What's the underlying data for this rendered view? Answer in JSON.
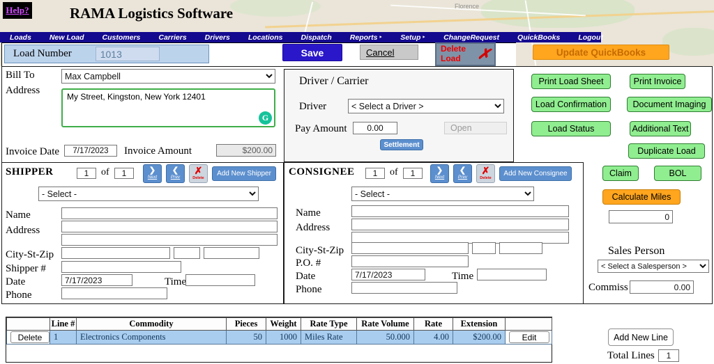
{
  "palette": {
    "nav_bg": "#140a8f",
    "save_blue": "#2a17c9",
    "button_green": "#90ee90",
    "button_orange": "#ffa51e",
    "delete_red": "#e00000",
    "steel_blue": "#5c8fce",
    "row_highlight": "#a9cdee",
    "load_number_bg": "#bcd3ec",
    "grammarly_green": "#15c39a"
  },
  "map": {
    "city_label": "Florence"
  },
  "header": {
    "help_label": "Help?",
    "title": "RAMA Logistics Software"
  },
  "nav": {
    "items": [
      "Loads",
      "New Load",
      "Customers",
      "Carriers",
      "Drivers",
      "Locations",
      "Dispatch",
      "Reports",
      "Setup",
      "ChangeRequest",
      "QuickBooks",
      "Logout"
    ]
  },
  "icons": {
    "submenu_arrow": "‣",
    "next_arrow": "❯",
    "prev_arrow": "❮",
    "delete_x": "✗",
    "grammarly": "G"
  },
  "toolbar": {
    "load_number_label": "Load Number",
    "load_number_value": "1013",
    "save": "Save",
    "cancel": "Cancel",
    "delete_load_line1": "Delete",
    "delete_load_line2": "Load",
    "update_quickbooks": "Update QuickBooks"
  },
  "bill_to": {
    "bill_to_label": "Bill To",
    "customer_selected": "Max Campbell",
    "address_label": "Address",
    "address_value": "My Street, Kingston, New York 12401",
    "invoice_date_label": "Invoice Date",
    "invoice_date": "7/17/2023",
    "invoice_amount_label": "Invoice Amount",
    "invoice_amount": "$200.00"
  },
  "driver_carrier": {
    "title": "Driver / Carrier",
    "driver_label": "Driver",
    "driver_selected": "< Select a Driver >",
    "pay_amount_label": "Pay Amount",
    "pay_amount": "0.00",
    "open_button": "Open",
    "settlement_button": "Settlement"
  },
  "actions": {
    "print_load_sheet": "Print Load Sheet",
    "print_invoice": "Print Invoice",
    "load_confirmation": "Load Confirmation",
    "document_imaging": "Document Imaging",
    "load_status": "Load Status",
    "additional_text": "Additional Text",
    "duplicate_load": "Duplicate Load",
    "claim": "Claim",
    "bol": "BOL",
    "calculate_miles": "Calculate Miles",
    "miles_value": "0",
    "sales_person_label": "Sales Person",
    "sales_person_selected": "< Select a Salesperson >",
    "commission_label": "Commiss",
    "commission_value": "0.00"
  },
  "shipper": {
    "title": "SHIPPER",
    "index_value": "1",
    "of_label": "of",
    "count_value": "1",
    "next_label": "Next",
    "prev_label": "Prev",
    "delete_label": "Delete",
    "add_new_label": "Add New Shipper",
    "select_selected": "- Select -",
    "name_label": "Name",
    "name_value": "",
    "address_label": "Address",
    "address1_value": "",
    "address2_value": "",
    "city_st_zip_label": "City-St-Zip",
    "city_value": "",
    "state_value": "",
    "zip_value": "",
    "number_label": "Shipper #",
    "number_value": "",
    "date_label": "Date",
    "date_value": "7/17/2023",
    "time_label": "Time",
    "time_value": "",
    "phone_label": "Phone",
    "phone_value": ""
  },
  "consignee": {
    "title": "CONSIGNEE",
    "index_value": "1",
    "of_label": "of",
    "count_value": "1",
    "next_label": "Next",
    "prev_label": "Prev",
    "delete_label": "Delete",
    "add_new_label": "Add New Consignee",
    "select_selected": "- Select -",
    "name_label": "Name",
    "name_value": "",
    "address_label": "Address",
    "address1_value": "",
    "address2_value": "",
    "city_st_zip_label": "City-St-Zip",
    "city_value": "",
    "state_value": "",
    "zip_value": "",
    "po_label": "P.O. #",
    "po_value": "",
    "date_label": "Date",
    "date_value": "7/17/2023",
    "time_label": "Time",
    "time_value": "",
    "phone_label": "Phone",
    "phone_value": ""
  },
  "lines": {
    "headers": {
      "line_no": "Line #",
      "commodity": "Commodity",
      "pieces": "Pieces",
      "weight": "Weight",
      "rate_type": "Rate Type",
      "rate_volume": "Rate Volume",
      "rate": "Rate",
      "extension": "Extension"
    },
    "rows": [
      {
        "delete_label": "Delete",
        "line_no": "1",
        "commodity": "Electronics Components",
        "pieces": "50",
        "weight": "1000",
        "rate_type": "Miles Rate",
        "rate_volume": "50.000",
        "rate": "4.00",
        "extension": "$200.00",
        "edit_label": "Edit"
      }
    ],
    "add_new_line": "Add New Line",
    "total_lines_label": "Total Lines",
    "total_lines_value": "1"
  }
}
